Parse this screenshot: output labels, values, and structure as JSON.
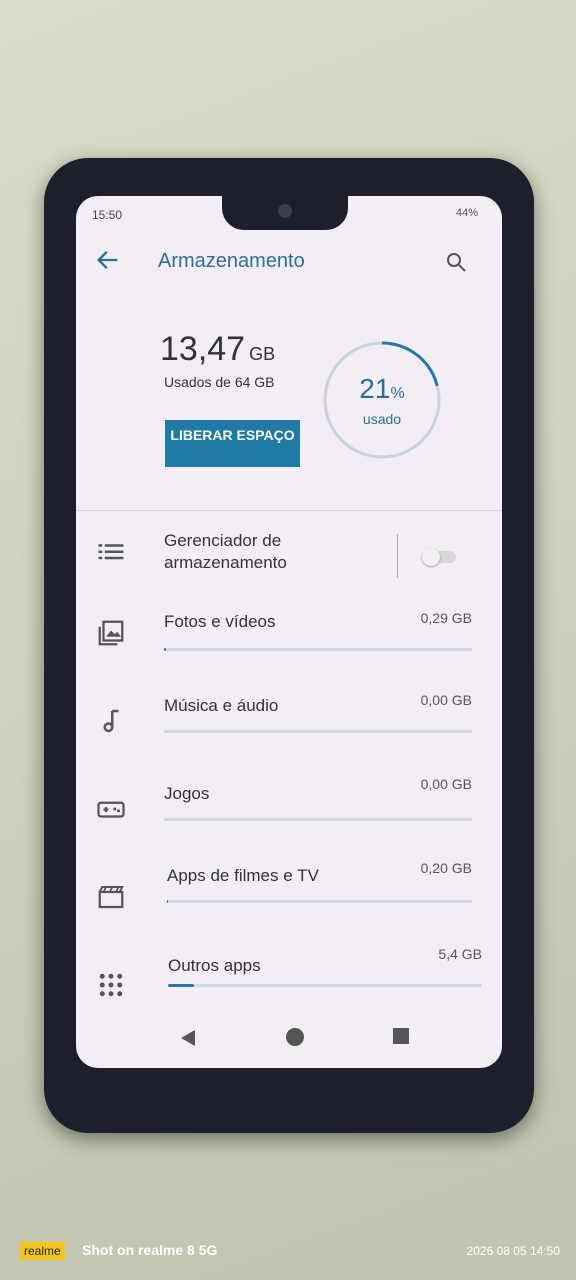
{
  "status_bar": {
    "time": "15:50",
    "battery": "44%"
  },
  "app_bar": {
    "title": "Armazenamento"
  },
  "summary": {
    "used_value": "13,47",
    "used_unit": "GB",
    "used_of": "Usados de 64 GB",
    "free_button": "LIBERAR ESPAÇO",
    "percent_value": "21",
    "percent_sign": "%",
    "percent_label": "usado",
    "percent_fraction": 0.21
  },
  "storage_manager": {
    "label": "Gerenciador de armazenamento",
    "enabled": false
  },
  "categories": [
    {
      "name": "Fotos e vídeos",
      "size": "0,29 GB",
      "icon": "photo-icon",
      "fill": 0.005
    },
    {
      "name": "Música e áudio",
      "size": "0,00 GB",
      "icon": "music-icon",
      "fill": 0
    },
    {
      "name": "Jogos",
      "size": "0,00 GB",
      "icon": "gamepad-icon",
      "fill": 0
    },
    {
      "name": "Apps de filmes e TV",
      "size": "0,20 GB",
      "icon": "movie-icon",
      "fill": 0.003
    },
    {
      "name": "Outros apps",
      "size": "5,4 GB",
      "icon": "apps-grid-icon",
      "fill": 0.084
    }
  ],
  "accent_color": "#1f7aa6",
  "watermark": {
    "brand": "realme",
    "text": "Shot on realme 8 5G",
    "date": "2026 08 05 14:50"
  }
}
